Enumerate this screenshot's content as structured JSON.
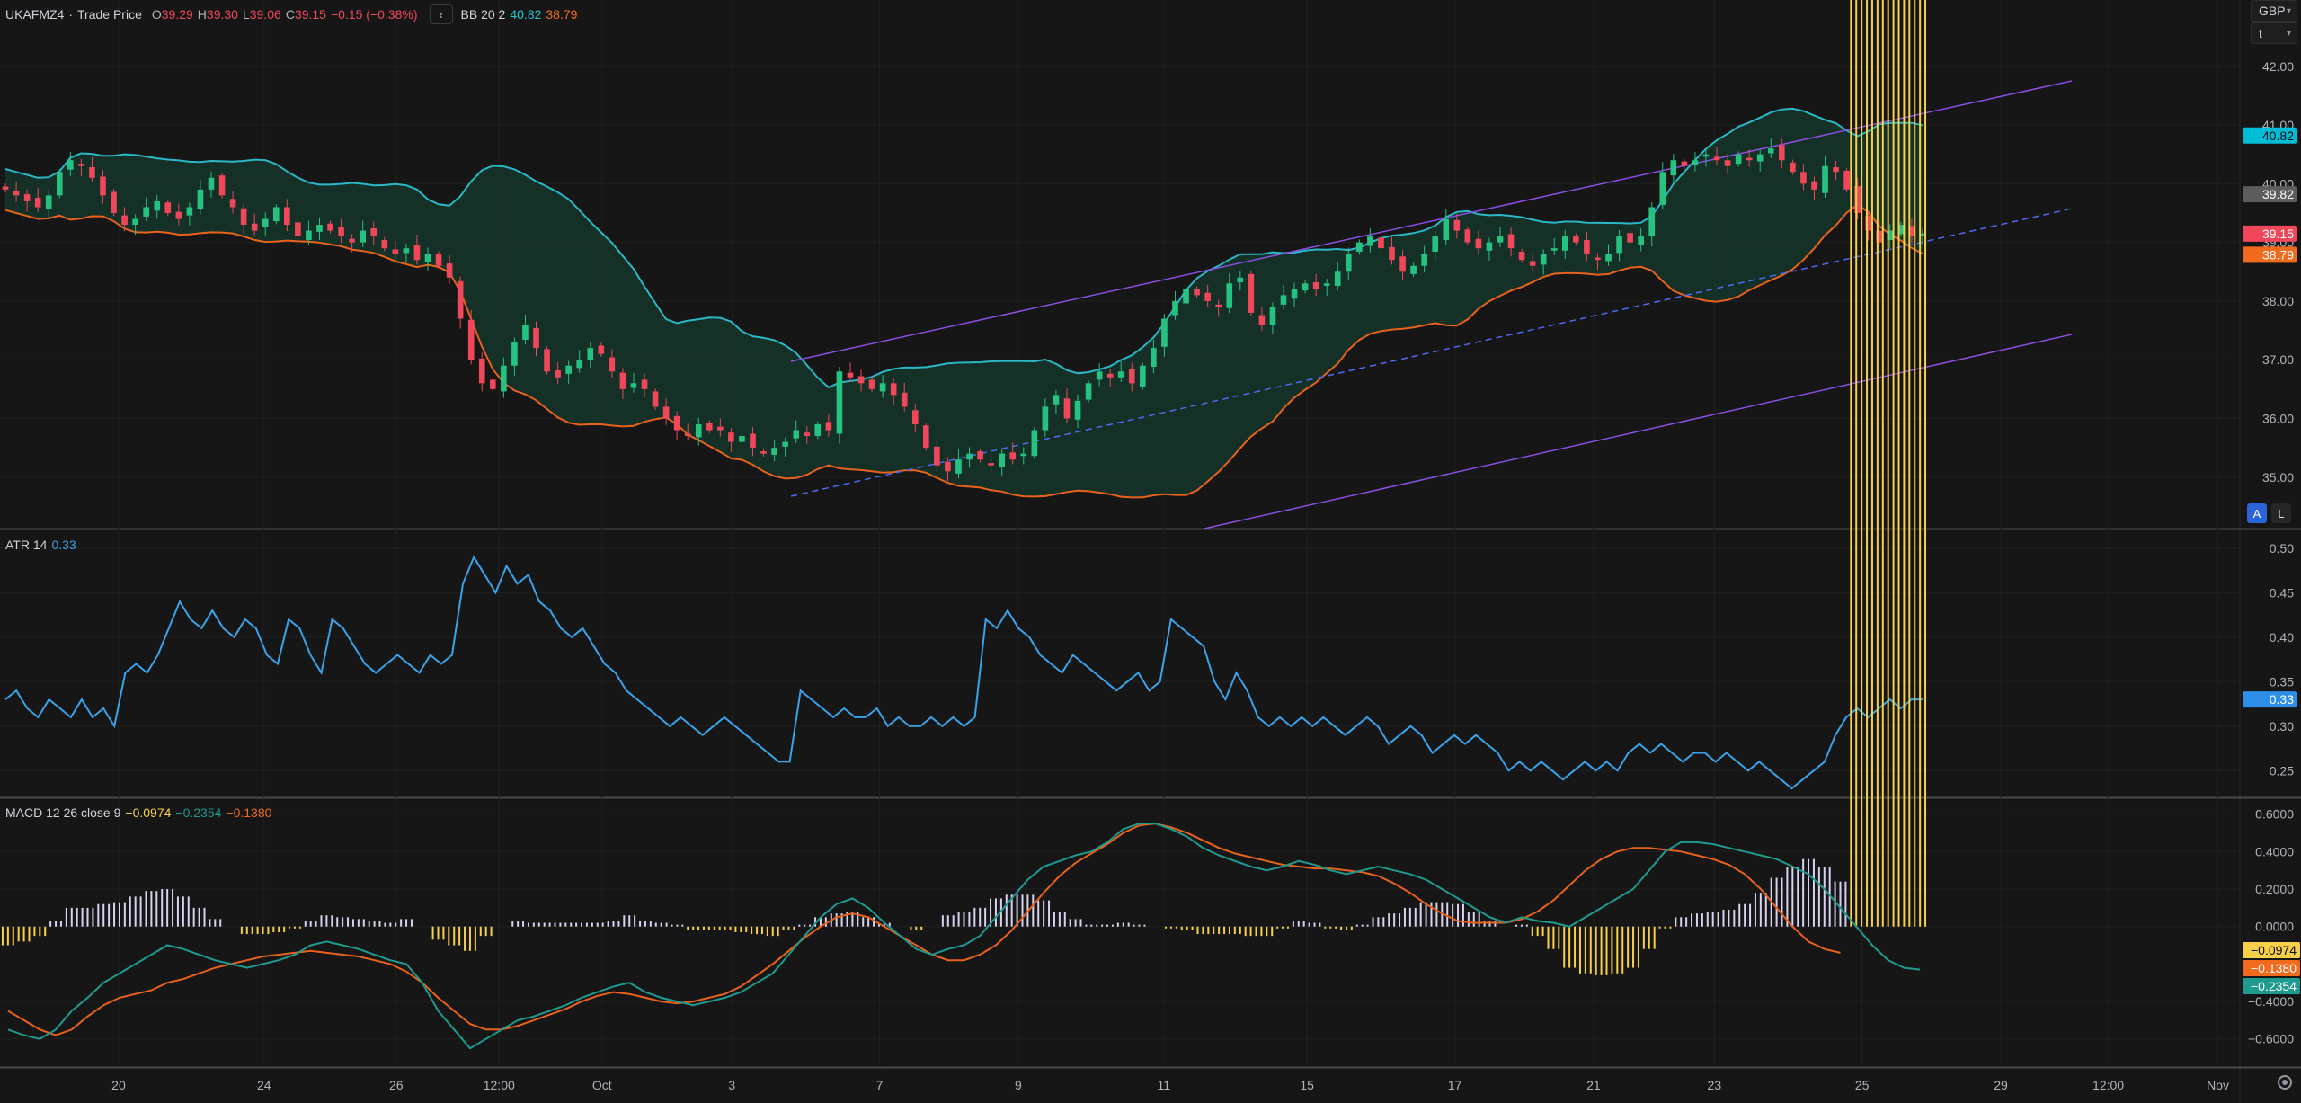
{
  "header": {
    "symbol": "UKAFMZ4",
    "separator": "·",
    "source": "Trade Price",
    "o_label": "O",
    "o_value": "39.29",
    "h_label": "H",
    "h_value": "39.30",
    "l_label": "L",
    "l_value": "39.06",
    "c_label": "C",
    "c_value": "39.15",
    "change": "−0.15 (−0.38%)",
    "collapse_icon": "chevron-left-icon",
    "bb_name": "BB 20 2",
    "bb_upper": "40.82",
    "bb_lower": "38.79"
  },
  "atr_legend": {
    "name": "ATR 14",
    "value": "0.33"
  },
  "macd_legend": {
    "name": "MACD 12 26 close 9",
    "hist": "−0.0974",
    "macd": "−0.2354",
    "signal": "−0.1380"
  },
  "top_right": {
    "currency": "GBP",
    "unit": "t"
  },
  "scale_buttons": {
    "auto": "A",
    "log": "L"
  },
  "colors": {
    "background": "#161616",
    "up": "#26c281",
    "down": "#f0475b",
    "bb_upper": "#2ab7c6",
    "bb_lower": "#e8621c",
    "bb_fill": "#163a2c",
    "channel": "#8a4fe0",
    "median": "#4a6cf0",
    "atr": "#3aa3ea",
    "macd": "#1f9a8f",
    "signal": "#e8621c",
    "hist_pos": "#d8d2f0",
    "hist_neg": "#f7d04a"
  },
  "price_axis": {
    "ticks": [
      "42.00",
      "41.00",
      "40.00",
      "39.00",
      "38.00",
      "37.00",
      "36.00",
      "35.00"
    ],
    "tick_values": [
      42,
      41,
      40,
      39,
      38,
      37,
      36,
      35
    ],
    "range": [
      34.2,
      42.9
    ],
    "badges": [
      {
        "label": "40.82",
        "value": 40.82,
        "bg": "#00bcd4",
        "fg": "#0b0b0b"
      },
      {
        "label": "39.82",
        "value": 39.82,
        "bg": "#5d5d5d",
        "fg": "#ffffff"
      },
      {
        "label": "39.15",
        "value": 39.15,
        "bg": "#f0475b",
        "fg": "#ffffff"
      },
      {
        "label": "38.79",
        "value": 38.79,
        "bg": "#f26b1d",
        "fg": "#ffffff"
      }
    ]
  },
  "atr_axis": {
    "ticks": [
      "0.50",
      "0.45",
      "0.40",
      "0.35",
      "0.30",
      "0.25"
    ],
    "tick_values": [
      0.5,
      0.45,
      0.4,
      0.35,
      0.3,
      0.25
    ],
    "range": [
      0.22,
      0.52
    ],
    "badge": {
      "label": "0.33",
      "value": 0.33,
      "bg": "#2e8fe8",
      "fg": "#ffffff"
    }
  },
  "macd_axis": {
    "ticks": [
      "0.6000",
      "0.4000",
      "0.2000",
      "0.0000",
      "−0.4000",
      "−0.6000"
    ],
    "tick_values": [
      0.6,
      0.4,
      0.2,
      0.0,
      -0.4,
      -0.6
    ],
    "range": [
      -0.75,
      0.68
    ],
    "badges": [
      {
        "label": "−0.0974",
        "value": -0.0974,
        "bg": "#f7d04a",
        "fg": "#0b0b0b"
      },
      {
        "label": "−0.1380",
        "value": -0.138,
        "bg": "#f26b1d",
        "fg": "#ffffff"
      },
      {
        "label": "−0.2354",
        "value": -0.2354,
        "bg": "#1f9a8f",
        "fg": "#ffffff"
      }
    ]
  },
  "time_axis": {
    "labels": [
      {
        "label": "20",
        "pos": 0.053
      },
      {
        "label": "24",
        "pos": 0.118
      },
      {
        "label": "26",
        "pos": 0.177
      },
      {
        "label": "12:00",
        "pos": 0.223
      },
      {
        "label": "Oct",
        "pos": 0.269
      },
      {
        "label": "3",
        "pos": 0.327
      },
      {
        "label": "7",
        "pos": 0.393
      },
      {
        "label": "9",
        "pos": 0.455
      },
      {
        "label": "11",
        "pos": 0.52
      },
      {
        "label": "15",
        "pos": 0.584
      },
      {
        "label": "17",
        "pos": 0.65
      },
      {
        "label": "21",
        "pos": 0.712
      },
      {
        "label": "23",
        "pos": 0.766
      },
      {
        "label": "25",
        "pos": 0.832
      },
      {
        "label": "29",
        "pos": 0.894
      },
      {
        "label": "12:00",
        "pos": 0.942
      },
      {
        "label": "Nov",
        "pos": 0.991
      }
    ]
  },
  "chart_data": [
    {
      "type": "candlestick",
      "name": "UKAFMZ4 Trade Price",
      "ylim": [
        34.2,
        42.9
      ],
      "close_series": [
        39.9,
        39.8,
        39.7,
        39.6,
        39.8,
        40.2,
        40.4,
        40.3,
        40.1,
        39.8,
        39.5,
        39.3,
        39.4,
        39.6,
        39.7,
        39.5,
        39.4,
        39.6,
        39.9,
        40.1,
        39.8,
        39.6,
        39.3,
        39.2,
        39.4,
        39.6,
        39.3,
        39.1,
        39.2,
        39.3,
        39.2,
        39.1,
        39.0,
        39.2,
        39.1,
        38.9,
        38.8,
        38.9,
        38.7,
        38.8,
        38.6,
        38.4,
        37.7,
        37.0,
        36.6,
        36.5,
        36.9,
        37.3,
        37.6,
        37.2,
        36.8,
        36.7,
        36.9,
        37.0,
        37.2,
        37.1,
        36.8,
        36.5,
        36.6,
        36.5,
        36.2,
        36.0,
        35.8,
        35.7,
        35.9,
        35.8,
        35.8,
        35.6,
        35.7,
        35.5,
        35.4,
        35.5,
        35.6,
        35.8,
        35.7,
        35.9,
        35.8,
        36.8,
        36.7,
        36.6,
        36.5,
        36.6,
        36.4,
        36.2,
        35.9,
        35.5,
        35.2,
        35.1,
        35.3,
        35.4,
        35.3,
        35.2,
        35.4,
        35.3,
        35.4,
        35.8,
        36.2,
        36.4,
        36.0,
        36.3,
        36.6,
        36.8,
        36.7,
        36.8,
        36.6,
        36.9,
        37.2,
        37.7,
        38.0,
        38.2,
        38.1,
        38.0,
        37.9,
        38.3,
        38.4,
        37.8,
        37.6,
        37.9,
        38.1,
        38.2,
        38.3,
        38.2,
        38.3,
        38.5,
        38.8,
        39.0,
        39.1,
        38.9,
        38.7,
        38.5,
        38.6,
        38.8,
        39.1,
        39.4,
        39.2,
        39.0,
        38.9,
        39.0,
        39.1,
        38.9,
        38.7,
        38.6,
        38.8,
        38.9,
        39.1,
        39.0,
        38.8,
        38.7,
        38.8,
        39.1,
        39.0,
        39.1,
        39.6,
        40.2,
        40.4,
        40.3,
        40.4,
        40.5,
        40.4,
        40.3,
        40.5,
        40.4,
        40.5,
        40.6,
        40.4,
        40.2,
        40.0,
        39.9,
        40.3,
        40.2,
        39.9,
        39.5,
        39.2,
        39.0,
        39.2,
        39.3,
        39.1,
        39.15
      ]
    },
    {
      "type": "line",
      "name": "ATR 14",
      "ylim": [
        0.22,
        0.52
      ],
      "values": [
        0.33,
        0.34,
        0.32,
        0.31,
        0.33,
        0.32,
        0.31,
        0.33,
        0.31,
        0.32,
        0.3,
        0.36,
        0.37,
        0.36,
        0.38,
        0.41,
        0.44,
        0.42,
        0.41,
        0.43,
        0.41,
        0.4,
        0.42,
        0.41,
        0.38,
        0.37,
        0.42,
        0.41,
        0.38,
        0.36,
        0.42,
        0.41,
        0.39,
        0.37,
        0.36,
        0.37,
        0.38,
        0.37,
        0.36,
        0.38,
        0.37,
        0.38,
        0.46,
        0.49,
        0.47,
        0.45,
        0.48,
        0.46,
        0.47,
        0.44,
        0.43,
        0.41,
        0.4,
        0.41,
        0.39,
        0.37,
        0.36,
        0.34,
        0.33,
        0.32,
        0.31,
        0.3,
        0.31,
        0.3,
        0.29,
        0.3,
        0.31,
        0.3,
        0.29,
        0.28,
        0.27,
        0.26,
        0.26,
        0.34,
        0.33,
        0.32,
        0.31,
        0.32,
        0.31,
        0.31,
        0.32,
        0.3,
        0.31,
        0.3,
        0.3,
        0.31,
        0.3,
        0.31,
        0.3,
        0.31,
        0.42,
        0.41,
        0.43,
        0.41,
        0.4,
        0.38,
        0.37,
        0.36,
        0.38,
        0.37,
        0.36,
        0.35,
        0.34,
        0.35,
        0.36,
        0.34,
        0.35,
        0.42,
        0.41,
        0.4,
        0.39,
        0.35,
        0.33,
        0.36,
        0.34,
        0.31,
        0.3,
        0.31,
        0.3,
        0.31,
        0.3,
        0.31,
        0.3,
        0.29,
        0.3,
        0.31,
        0.3,
        0.28,
        0.29,
        0.3,
        0.29,
        0.27,
        0.28,
        0.29,
        0.28,
        0.29,
        0.28,
        0.27,
        0.25,
        0.26,
        0.25,
        0.26,
        0.25,
        0.24,
        0.25,
        0.26,
        0.25,
        0.26,
        0.25,
        0.27,
        0.28,
        0.27,
        0.28,
        0.27,
        0.26,
        0.27,
        0.27,
        0.26,
        0.27,
        0.26,
        0.25,
        0.26,
        0.25,
        0.24,
        0.23,
        0.24,
        0.25,
        0.26,
        0.29,
        0.31,
        0.32,
        0.31,
        0.32,
        0.33,
        0.32,
        0.33,
        0.33
      ]
    },
    {
      "type": "line+bar",
      "name": "MACD 12 26 close 9",
      "ylim": [
        -0.75,
        0.68
      ],
      "series": [
        {
          "name": "MACD",
          "values": [
            -0.55,
            -0.58,
            -0.6,
            -0.55,
            -0.45,
            -0.38,
            -0.3,
            -0.25,
            -0.2,
            -0.15,
            -0.1,
            -0.12,
            -0.15,
            -0.18,
            -0.2,
            -0.22,
            -0.2,
            -0.18,
            -0.15,
            -0.1,
            -0.08,
            -0.1,
            -0.12,
            -0.15,
            -0.18,
            -0.2,
            -0.3,
            -0.45,
            -0.55,
            -0.65,
            -0.6,
            -0.55,
            -0.5,
            -0.48,
            -0.45,
            -0.42,
            -0.38,
            -0.35,
            -0.32,
            -0.3,
            -0.35,
            -0.38,
            -0.4,
            -0.42,
            -0.4,
            -0.38,
            -0.35,
            -0.3,
            -0.25,
            -0.15,
            -0.05,
            0.05,
            0.12,
            0.15,
            0.1,
            0.02,
            -0.05,
            -0.12,
            -0.15,
            -0.12,
            -0.1,
            -0.05,
            0.05,
            0.15,
            0.25,
            0.32,
            0.35,
            0.38,
            0.4,
            0.45,
            0.52,
            0.55,
            0.55,
            0.52,
            0.48,
            0.42,
            0.38,
            0.35,
            0.32,
            0.3,
            0.32,
            0.35,
            0.33,
            0.3,
            0.28,
            0.3,
            0.32,
            0.3,
            0.28,
            0.25,
            0.2,
            0.15,
            0.1,
            0.05,
            0.02,
            0.05,
            0.03,
            0.02,
            0.0,
            0.05,
            0.1,
            0.15,
            0.2,
            0.3,
            0.4,
            0.45,
            0.45,
            0.44,
            0.42,
            0.4,
            0.38,
            0.36,
            0.32,
            0.28,
            0.2,
            0.1,
            0.0,
            -0.1,
            -0.18,
            -0.22,
            -0.23
          ]
        },
        {
          "name": "Signal",
          "values": [
            -0.45,
            -0.5,
            -0.55,
            -0.58,
            -0.55,
            -0.48,
            -0.42,
            -0.38,
            -0.36,
            -0.34,
            -0.3,
            -0.28,
            -0.25,
            -0.22,
            -0.2,
            -0.18,
            -0.16,
            -0.15,
            -0.14,
            -0.13,
            -0.14,
            -0.15,
            -0.16,
            -0.18,
            -0.2,
            -0.24,
            -0.3,
            -0.38,
            -0.45,
            -0.52,
            -0.55,
            -0.55,
            -0.53,
            -0.5,
            -0.47,
            -0.44,
            -0.4,
            -0.37,
            -0.35,
            -0.36,
            -0.38,
            -0.4,
            -0.41,
            -0.4,
            -0.38,
            -0.36,
            -0.32,
            -0.26,
            -0.2,
            -0.13,
            -0.06,
            0.0,
            0.05,
            0.07,
            0.05,
            0.0,
            -0.05,
            -0.1,
            -0.15,
            -0.18,
            -0.18,
            -0.15,
            -0.1,
            -0.02,
            0.08,
            0.18,
            0.27,
            0.34,
            0.39,
            0.44,
            0.5,
            0.54,
            0.55,
            0.53,
            0.5,
            0.46,
            0.42,
            0.39,
            0.37,
            0.35,
            0.33,
            0.32,
            0.31,
            0.31,
            0.3,
            0.29,
            0.27,
            0.23,
            0.18,
            0.12,
            0.07,
            0.03,
            0.02,
            0.02,
            0.02,
            0.04,
            0.08,
            0.14,
            0.22,
            0.3,
            0.36,
            0.4,
            0.42,
            0.42,
            0.41,
            0.4,
            0.38,
            0.36,
            0.33,
            0.28,
            0.2,
            0.1,
            0.0,
            -0.08,
            -0.12,
            -0.14
          ]
        }
      ]
    }
  ]
}
